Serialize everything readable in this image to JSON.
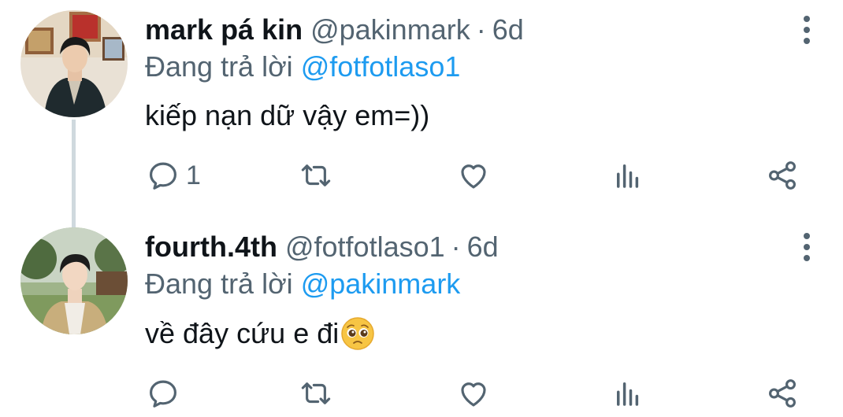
{
  "tweets": [
    {
      "display_name": "mark pá kin",
      "handle": "@pakinmark",
      "separator": "·",
      "time": "6d",
      "replying_prefix": "Đang trả lời",
      "replying_to": "@fotfotlaso1",
      "text": "kiếp nạn dữ vậy em=))",
      "reply_count": "1",
      "avatar_icon": "profile-photo"
    },
    {
      "display_name": "fourth.4th",
      "handle": "@fotfotlaso1",
      "separator": "·",
      "time": "6d",
      "replying_prefix": "Đang trả lời",
      "replying_to": "@pakinmark",
      "text": "về đây cứu e đi",
      "emoji_icon": "pleading-face-emoji",
      "reply_count": "",
      "avatar_icon": "profile-photo"
    }
  ],
  "colors": {
    "text": "#0f1419",
    "secondary": "#536471",
    "link": "#1d9bf0",
    "thread_line": "#cfd9de"
  },
  "icons": [
    "reply-icon",
    "retweet-icon",
    "like-icon",
    "views-icon",
    "share-icon",
    "more-icon"
  ]
}
